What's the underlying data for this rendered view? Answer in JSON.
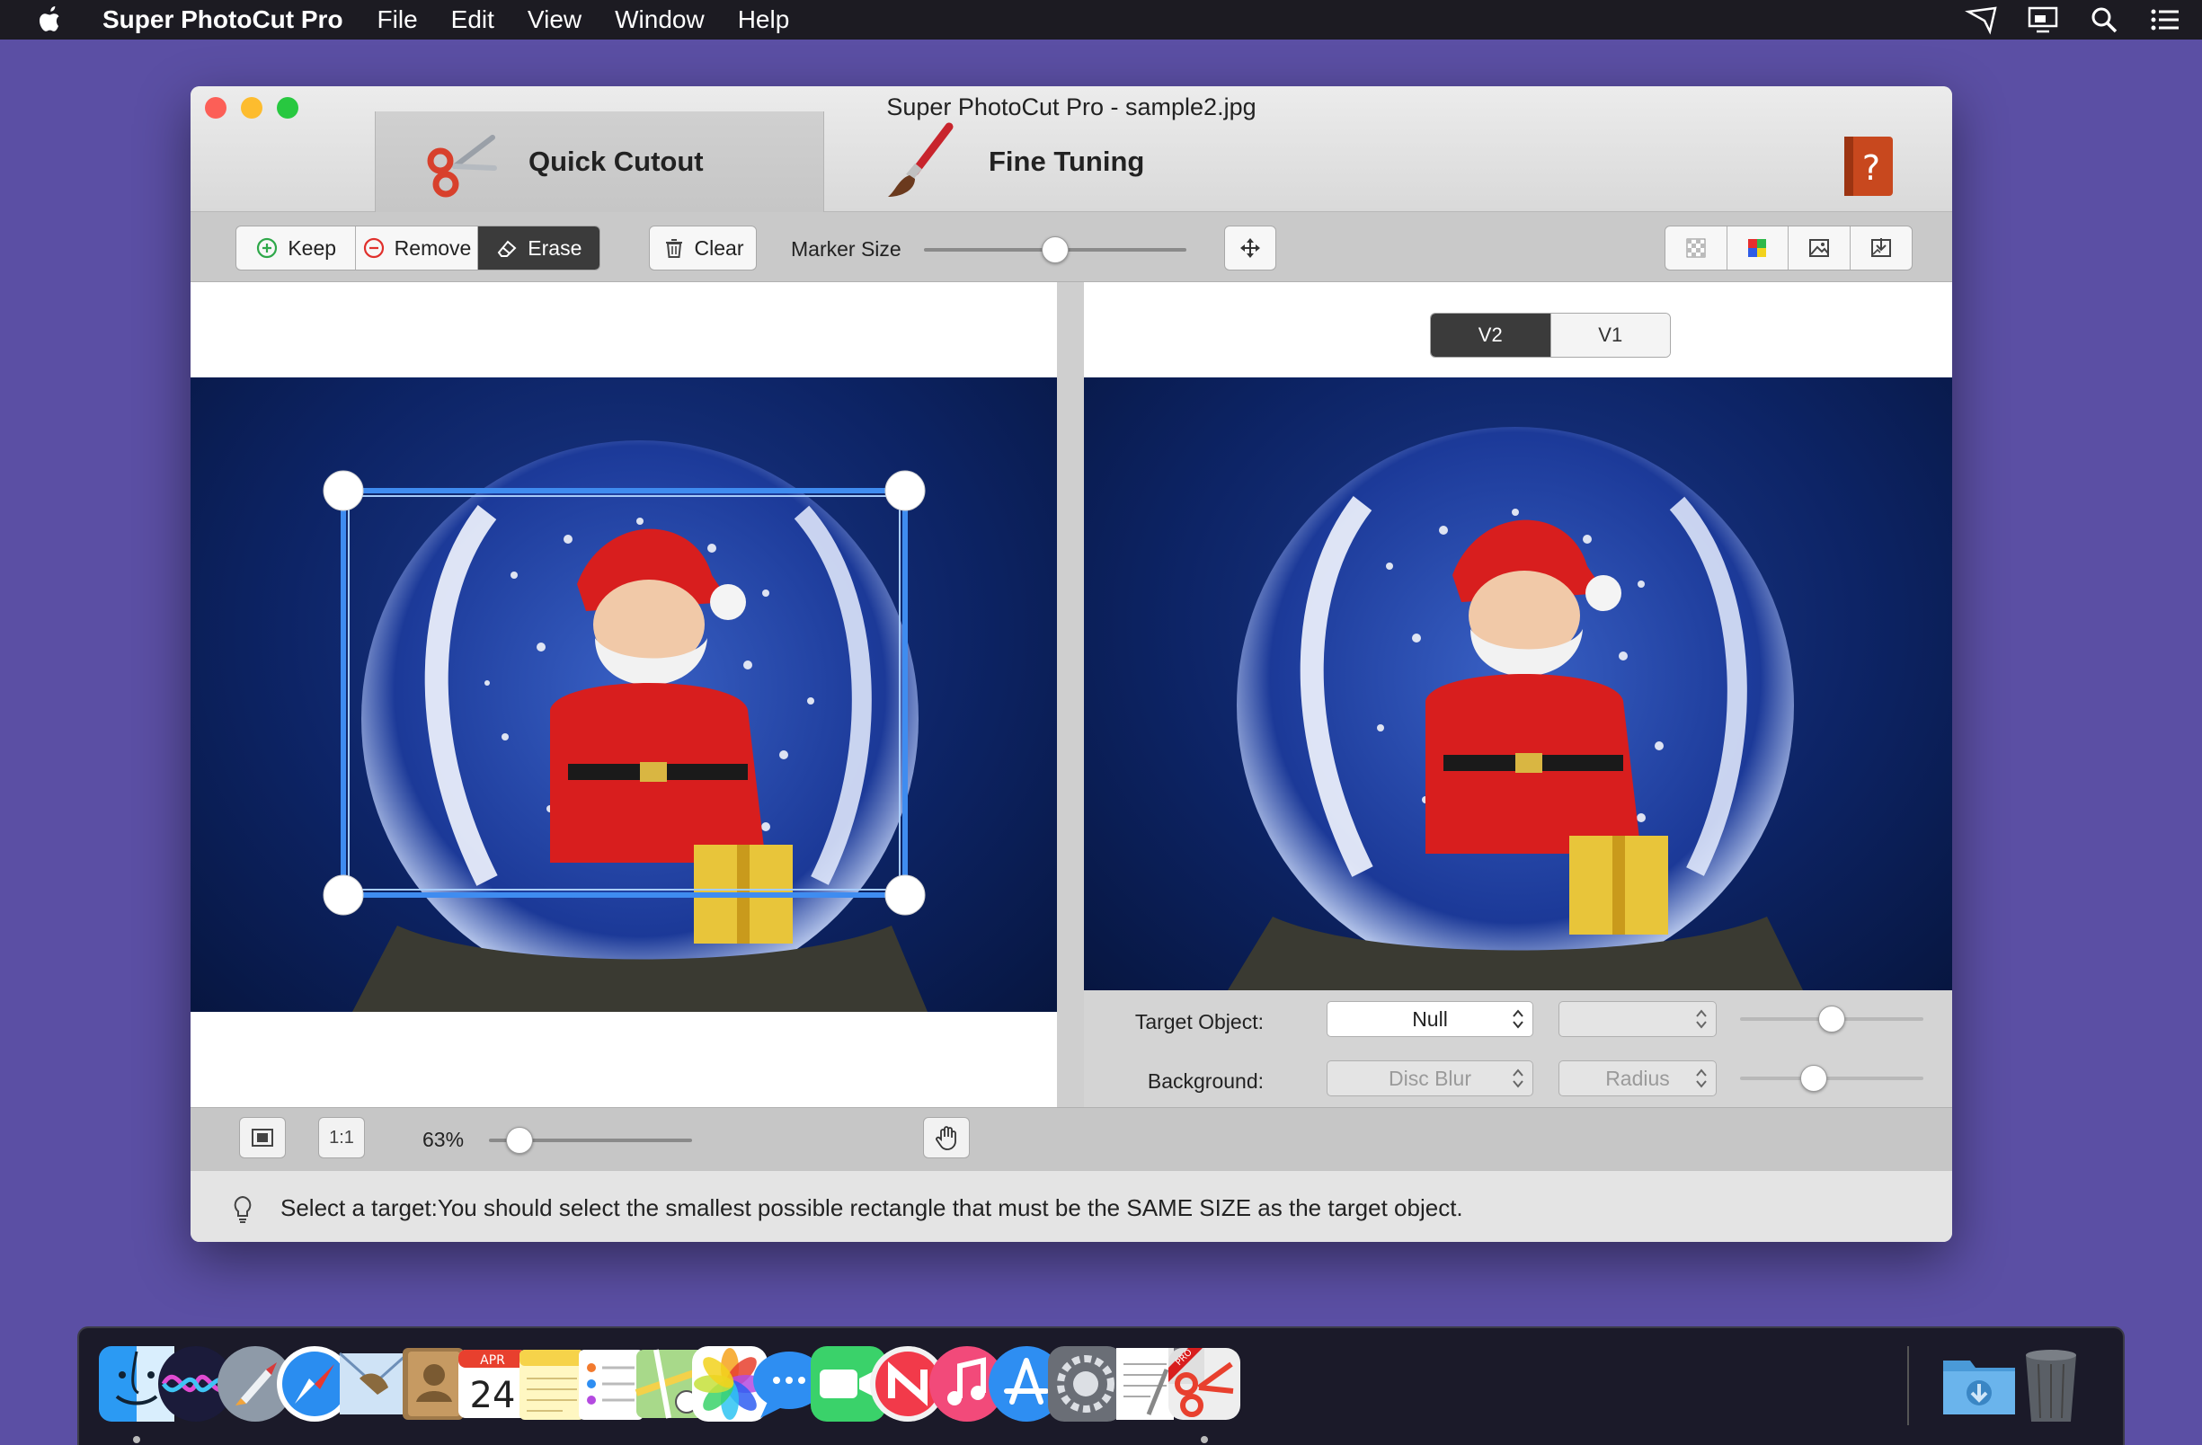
{
  "menubar": {
    "app_name": "Super PhotoCut Pro",
    "items": [
      "File",
      "Edit",
      "View",
      "Window",
      "Help"
    ]
  },
  "window": {
    "title": "Super PhotoCut Pro - sample2.jpg",
    "tabs": {
      "quick": "Quick Cutout",
      "fine": "Fine Tuning"
    }
  },
  "toolbar": {
    "keep": "Keep",
    "remove": "Remove",
    "erase": "Erase",
    "clear": "Clear",
    "marker_size_label": "Marker Size",
    "marker_size_value": 0.5
  },
  "preview": {
    "versions": [
      "V2",
      "V1"
    ],
    "selected_version": "V2"
  },
  "options": {
    "target_label": "Target Object:",
    "target_value": "Null",
    "target_slider": 0.5,
    "background_label": "Background:",
    "background_value": "Disc Blur",
    "radius_value": "Radius",
    "radius_slider": 0.4
  },
  "zoombar": {
    "actual_size": "1:1",
    "zoom": "63%",
    "zoom_slider": 0.15
  },
  "hint": {
    "text": "Select a target:You should select the smallest possible rectangle that must be the SAME SIZE as the target object."
  },
  "colors": {
    "accent_selection": "#3f8cf0",
    "desktop": "#5b4fa4"
  },
  "dock": {
    "apps": [
      "finder-icon",
      "siri-icon",
      "launchpad-icon",
      "safari-icon",
      "mail-icon",
      "contacts-icon",
      "calendar-icon",
      "notes-icon",
      "reminders-icon",
      "maps-icon",
      "photos-icon",
      "messages-icon",
      "facetime-icon",
      "news-icon",
      "music-icon",
      "app-store-icon",
      "system-preferences-icon",
      "textedit-icon",
      "super-photocut-icon",
      "downloads-folder-icon",
      "trash-icon"
    ],
    "calendar_month": "APR",
    "calendar_day": "24",
    "app_badge": "PRO"
  }
}
